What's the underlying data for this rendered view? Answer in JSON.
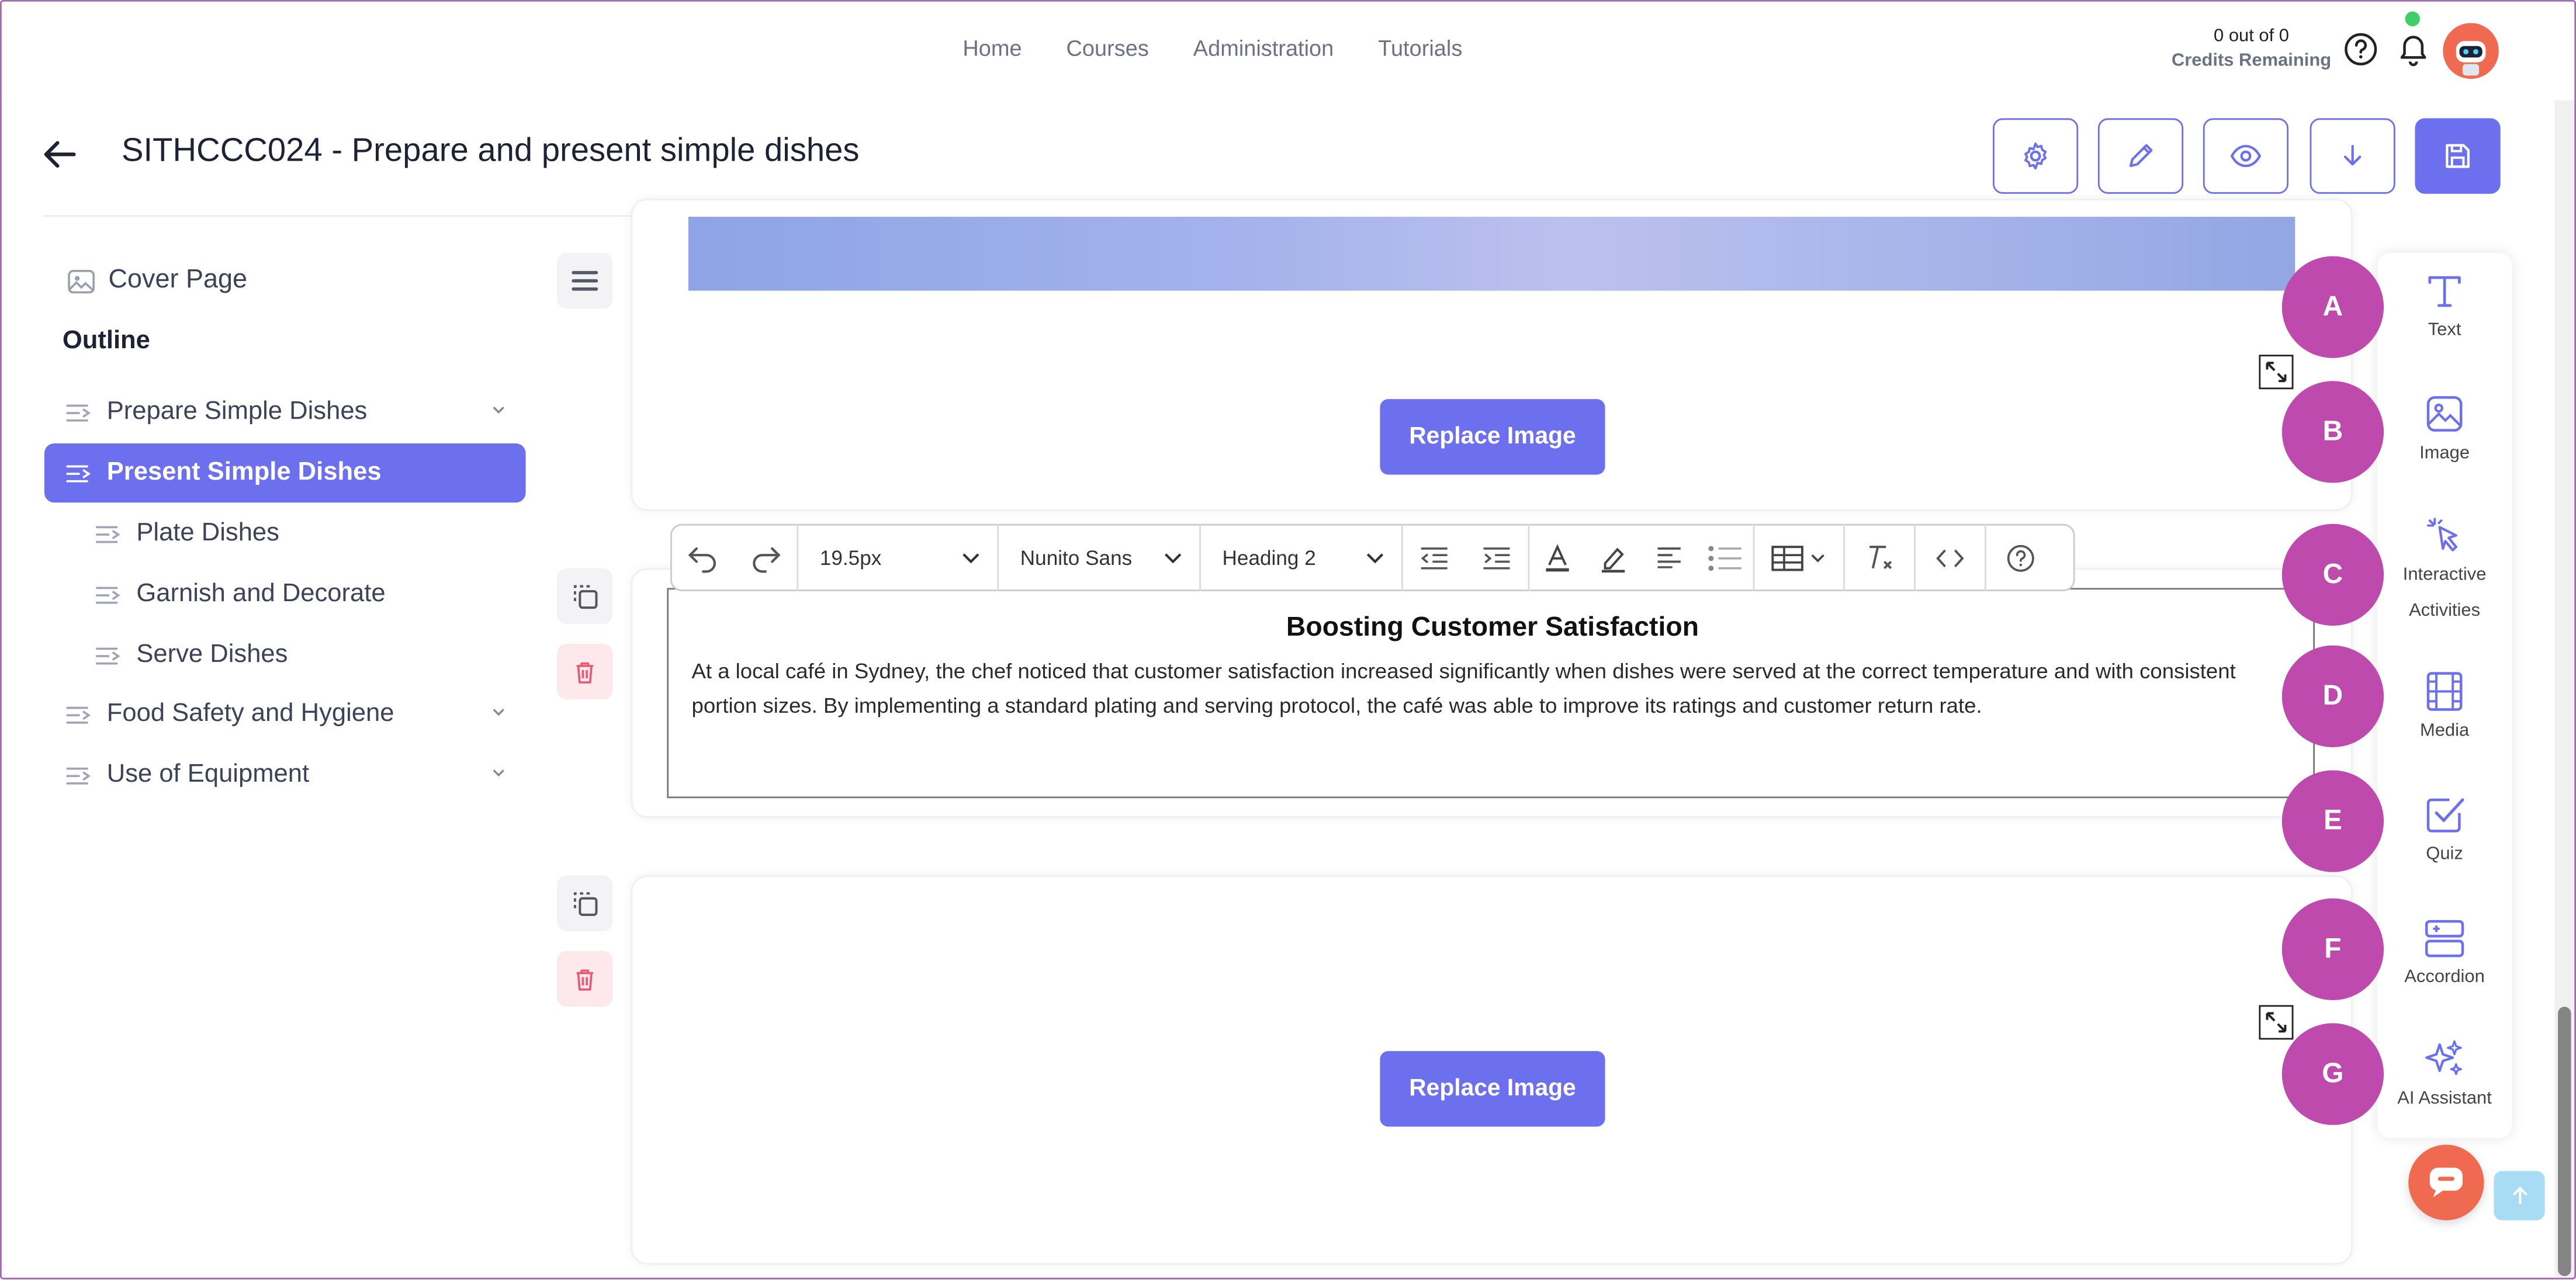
{
  "nav": {
    "links": [
      "Home",
      "Courses",
      "Administration",
      "Tutorials"
    ]
  },
  "credits": {
    "line1": "0 out of 0",
    "line2": "Credits Remaining"
  },
  "page": {
    "title": "SITHCCC024 - Prepare and present simple dishes"
  },
  "header_icons": [
    "back-arrow-icon",
    "gear-icon",
    "pencil-icon",
    "eye-icon",
    "download-icon",
    "save-icon"
  ],
  "sidebar": {
    "cover": "Cover Page",
    "outline": "Outline",
    "items": [
      {
        "label": "Prepare Simple Dishes",
        "expandable": true
      },
      {
        "label": "Present Simple Dishes",
        "active": true
      },
      {
        "label": "Plate Dishes"
      },
      {
        "label": "Garnish and Decorate"
      },
      {
        "label": "Serve Dishes"
      },
      {
        "label": "Food Safety and Hygiene",
        "expandable": true
      },
      {
        "label": "Use of Equipment",
        "expandable": true
      }
    ]
  },
  "content": {
    "replace_label": "Replace Image",
    "heading": "Boosting Customer Satisfaction",
    "paragraph": "At a local café in Sydney, the chef noticed that customer satisfaction increased significantly when dishes were served at the correct temperature and with consistent portion sizes. By implementing a standard plating and serving protocol, the café was able to improve its ratings and customer return rate."
  },
  "toolbar": {
    "font_size": "19.5px",
    "font_family": "Nunito Sans",
    "block_style": "Heading 2"
  },
  "right_panel": {
    "items": [
      {
        "label": "Text",
        "marker": "A"
      },
      {
        "label": "Image",
        "marker": "B"
      },
      {
        "label": "Interactive Activities",
        "marker": "C"
      },
      {
        "label": "Media",
        "marker": "D"
      },
      {
        "label": "Quiz",
        "marker": "E"
      },
      {
        "label": "Accordion",
        "marker": "F"
      },
      {
        "label": "AI Assistant",
        "marker": "G"
      }
    ]
  },
  "colors": {
    "accent": "#6c70ee",
    "marker": "#bf4aae",
    "chat": "#ef6a50",
    "text": "#1e2235"
  }
}
